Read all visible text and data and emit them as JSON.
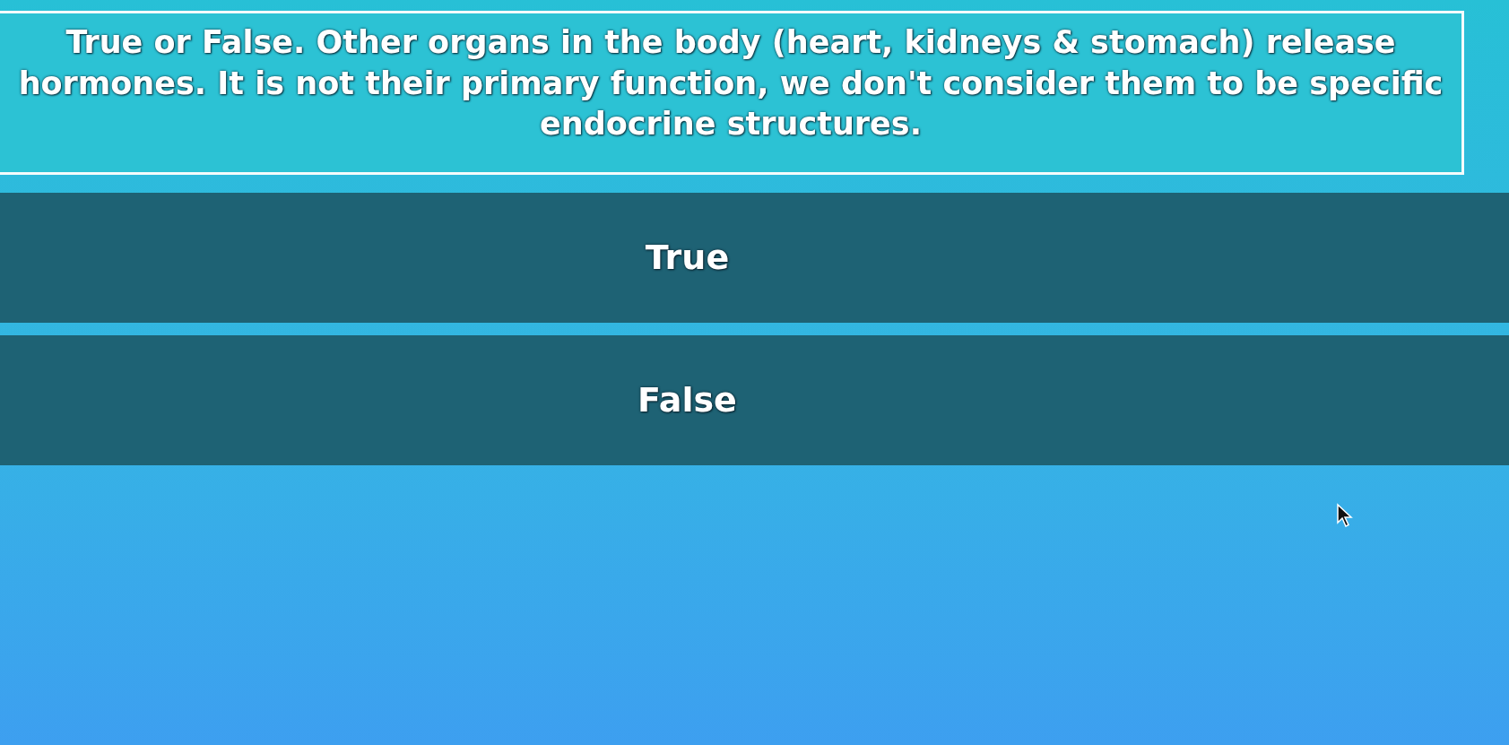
{
  "question": {
    "text": "True or False. Other organs in the body (heart, kidneys & stomach) release hormones. It is not their primary function, we don't consider them to be specific endocrine structures."
  },
  "answers": [
    {
      "label": "True",
      "selected": false
    },
    {
      "label": "False",
      "selected": false
    }
  ]
}
